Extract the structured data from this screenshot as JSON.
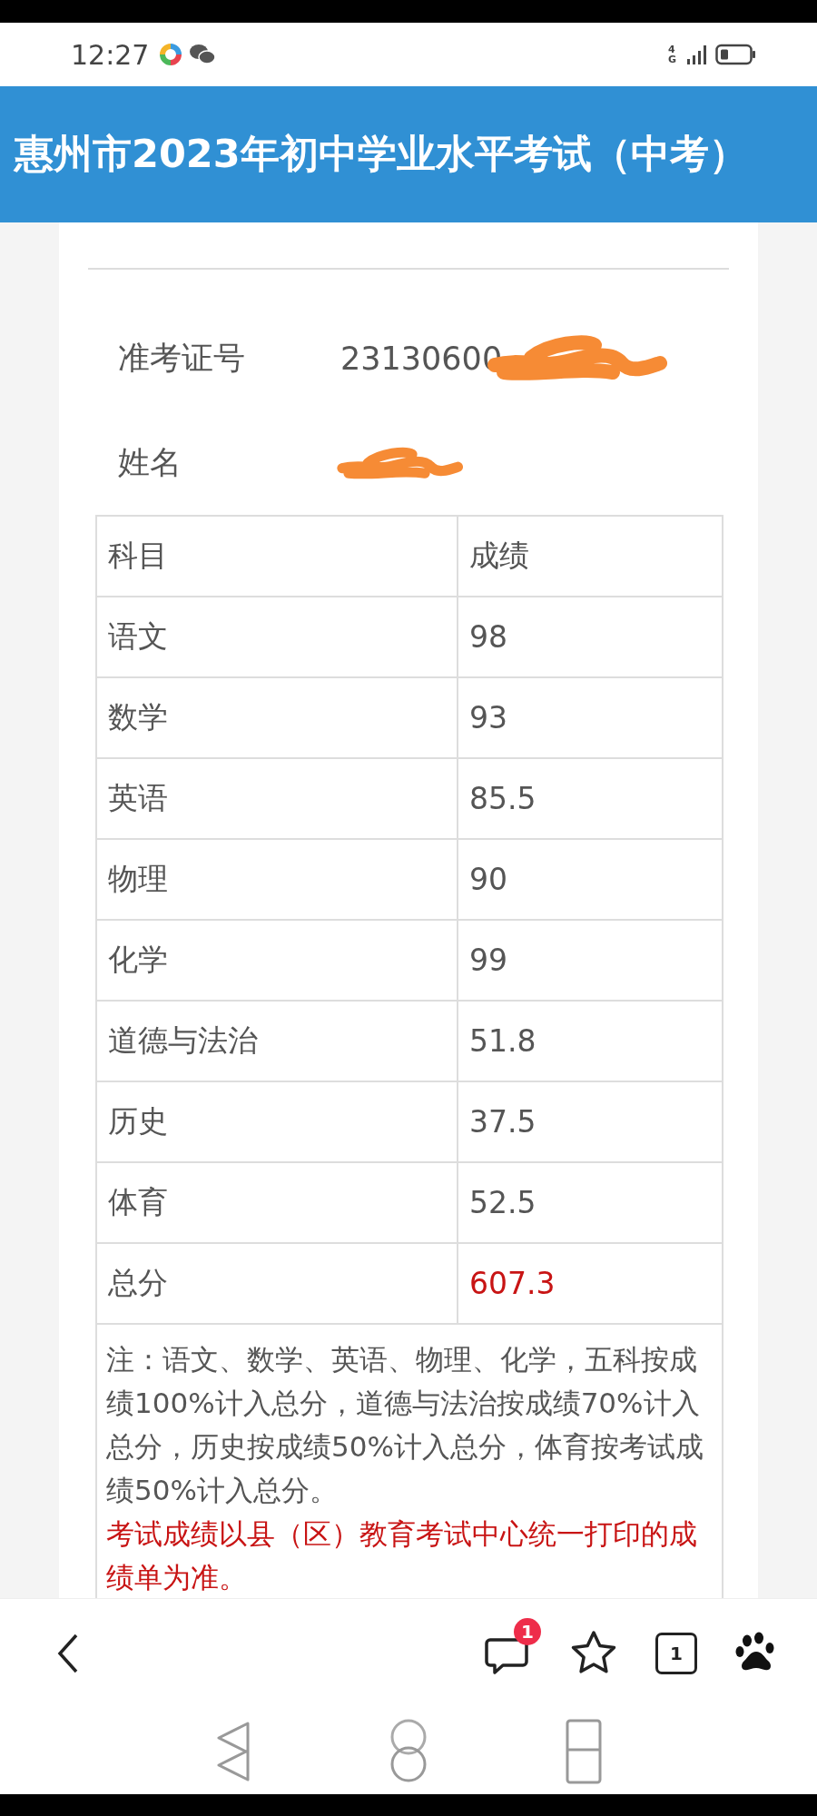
{
  "status_bar": {
    "time": "12:27",
    "network": "4G"
  },
  "header": {
    "title": "惠州市2023年初中学业水平考试（中考）"
  },
  "info": [
    {
      "label": "准考证号",
      "value": "23130600",
      "redacted": true
    },
    {
      "label": "姓名",
      "redacted": true
    }
  ],
  "table": {
    "columns": [
      "科目",
      "成绩"
    ],
    "rows": [
      {
        "subject": "语文",
        "score": "98",
        "highlight": false
      },
      {
        "subject": "数学",
        "score": "93",
        "highlight": false
      },
      {
        "subject": "英语",
        "score": "85.5",
        "highlight": false
      },
      {
        "subject": "物理",
        "score": "90",
        "highlight": false
      },
      {
        "subject": "化学",
        "score": "99",
        "highlight": false
      },
      {
        "subject": "道德与法治",
        "score": "51.8",
        "highlight": false
      },
      {
        "subject": "历史",
        "score": "37.5",
        "highlight": false
      },
      {
        "subject": "体育",
        "score": "52.5",
        "highlight": false
      },
      {
        "subject": "总分",
        "score": "607.3",
        "highlight": true
      }
    ]
  },
  "note": {
    "text": "注：语文、数学、英语、物理、化学，五科按成绩100%计入总分，道德与法治按成绩70%计入总分，历史按成绩50%计入总分，体育按考试成绩50%计入总分。",
    "warning": "考试成绩以县（区）教育考试中心统一打印的成绩单为准。"
  },
  "toolbar": {
    "comment_badge": "1",
    "tab_count": "1"
  }
}
